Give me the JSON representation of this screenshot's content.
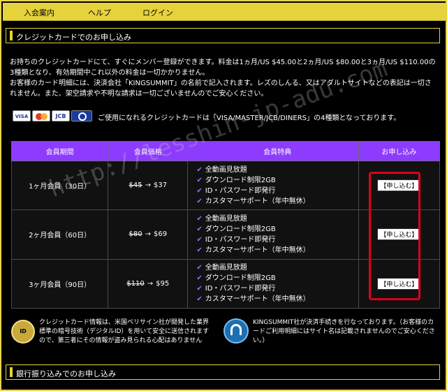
{
  "nav": {
    "items": [
      "入会案内",
      "ヘルプ",
      "ログイン"
    ]
  },
  "credit_section": {
    "title": "クレジットカードでのお申し込み",
    "intro": "お持ちのクレジットカードにて、すぐにメンバー登録ができます。料金は1ヵ月/US $45.00と2ヵ月/US $80.00と3ヵ月/US $110.00の3種類となり、有効期間中これ以外の料金は一切かかりません。\nお客様のカード明細には、決済会社「KINGSUMMIT」の名前で記入されます。レズのしんる、又はアダルトサイトなどの表記は一切されません。また、架空請求や不明な請求は一切ございませんのでご安心ください。",
    "cards_note": "ご使用になれるクレジットカードは「VISA/MASTER/JCB/DINERS」の4種類となっております。",
    "card_logos": [
      "VISA",
      "MasterCard",
      "JCB",
      "Diners"
    ]
  },
  "table": {
    "headers": [
      "会員期間",
      "会員価格",
      "会員特典",
      "お申し込み"
    ],
    "rows": [
      {
        "period": "1ヶ月会員（30日）",
        "old_price": "$45",
        "arrow": "→",
        "new_price": "$37",
        "benefits": [
          "全動画見放題",
          "ダウンロード制限2GB",
          "ID・パスワード即発行",
          "カスタマーサポート（年中無休）"
        ],
        "button": "【申し込む】"
      },
      {
        "period": "2ヶ月会員（60日）",
        "old_price": "$80",
        "arrow": "→",
        "new_price": "$69",
        "benefits": [
          "全動画見放題",
          "ダウンロード制限2GB",
          "ID・パスワード即発行",
          "カスタマーサポート（年中無休）"
        ],
        "button": "【申し込む】"
      },
      {
        "period": "3ヶ月会員（90日）",
        "old_price": "$110",
        "arrow": "→",
        "new_price": "$95",
        "benefits": [
          "全動画見放題",
          "ダウンロード制限2GB",
          "ID・パスワード即発行",
          "カスタマーサポート（年中無休）"
        ],
        "button": "【申し込む】"
      }
    ]
  },
  "security": {
    "badge": "ID",
    "text": "クレジットカード情報は、米国ベリサイン社が開発した業界標準の暗号技術（デジタルID）を用いて安全に送信されますので、第三者にその情報が盗み見られる心配はありません"
  },
  "support": {
    "text": "KINGSUMMIT社が決済手続きを行なっております。（お客様のカードご利用明細にはサイト名は記載されませんのでご安心ください。）"
  },
  "bank_section": {
    "title": "銀行振り込みでのお申し込み"
  },
  "watermark": "http://lesshin-jp-adu.com",
  "colors": {
    "accent": "#e6d23b",
    "table_header": "#8d3bff",
    "highlight": "#e0001b"
  }
}
